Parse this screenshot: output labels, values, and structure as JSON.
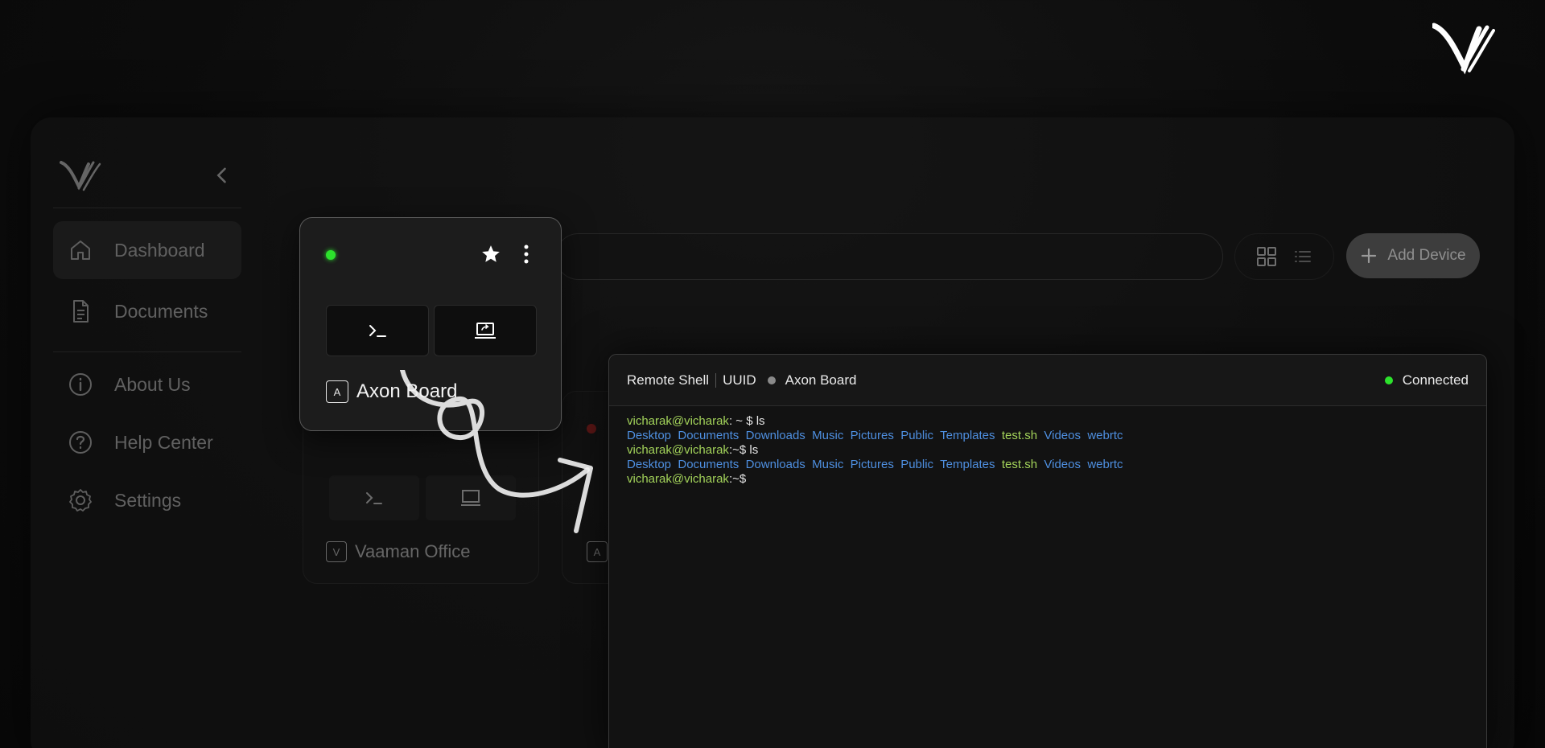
{
  "sidebar": {
    "items": [
      {
        "label": "Dashboard",
        "icon": "home-icon",
        "active": true
      },
      {
        "label": "Documents",
        "icon": "document-icon"
      },
      {
        "label": "About Us",
        "icon": "info-icon"
      },
      {
        "label": "Help Center",
        "icon": "help-icon"
      },
      {
        "label": "Settings",
        "icon": "gear-icon"
      }
    ]
  },
  "toolbar": {
    "add_device_label": "Add Device",
    "view_modes": [
      "grid-view-icon",
      "list-view-icon"
    ]
  },
  "featured_device": {
    "status": "online",
    "status_color": "#2ce22c",
    "letter": "A",
    "name": "Axon Board"
  },
  "devices": [
    {
      "letter": "V",
      "name": "Vaaman Office",
      "status_color": "#b8201d"
    },
    {
      "letter": "A",
      "status_color": "#b8201d"
    }
  ],
  "terminal": {
    "title": "Remote Shell",
    "uuid_label": "UUID",
    "device_name": "Axon Board",
    "connection_status": "Connected",
    "lines": [
      {
        "user": "vicharak@vicharak",
        "path_sep": ": ~ $ ",
        "command": "ls"
      },
      {
        "listing": [
          "Desktop",
          "Documents",
          "Downloads",
          "Music",
          "Pictures",
          "Public",
          "Templates",
          "test.sh",
          "Videos",
          "webrtc"
        ]
      },
      {
        "user": "vicharak@vicharak",
        "path_sep": ":~$ ",
        "command": "ls"
      },
      {
        "listing": [
          "Desktop",
          "Documents",
          "Downloads",
          "Music",
          "Pictures",
          "Public",
          "Templates",
          "test.sh",
          "Videos",
          "webrtc"
        ]
      },
      {
        "user": "vicharak@vicharak",
        "path_sep": ":~$",
        "command": ""
      }
    ]
  },
  "colors": {
    "accent_green": "#2ce22c",
    "prompt_green": "#a3d35a",
    "dir_blue": "#4e8fe0",
    "offline_red": "#b8201d"
  }
}
